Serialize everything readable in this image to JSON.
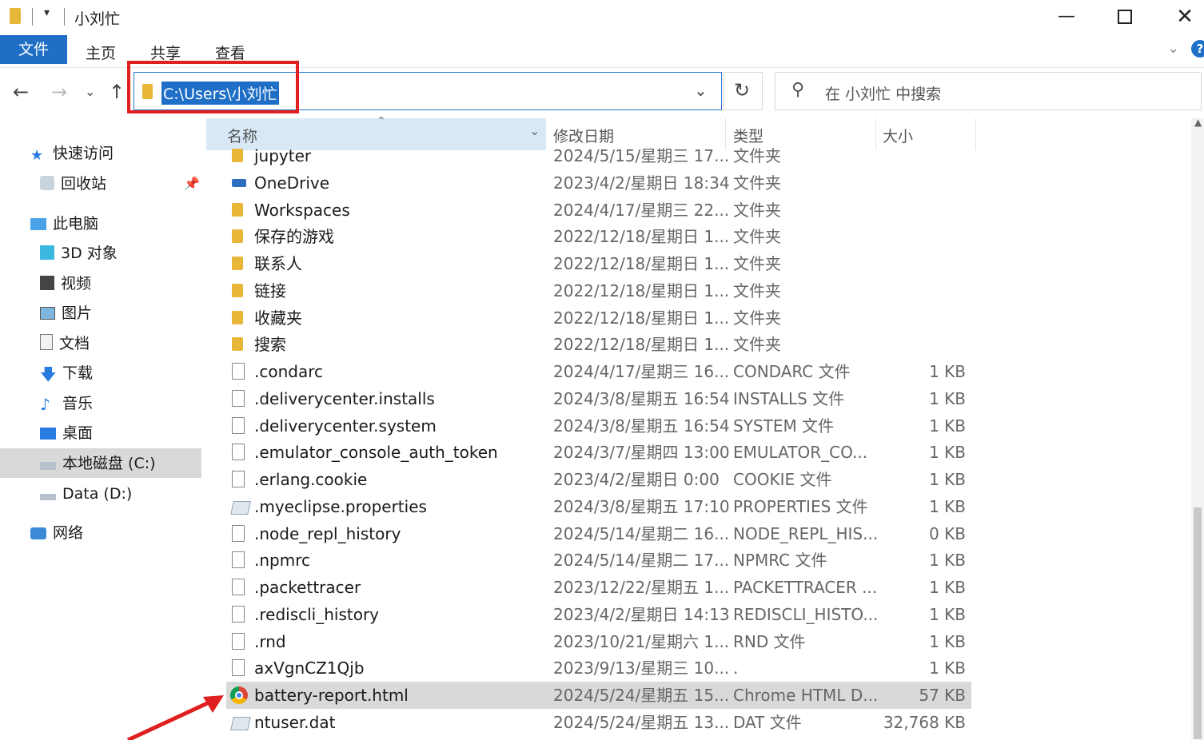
{
  "window": {
    "title": "小刘忙"
  },
  "ribbon": {
    "tabs": [
      "文件",
      "主页",
      "共享",
      "查看"
    ],
    "help": "?"
  },
  "address": {
    "path": "C:\\Users\\小刘忙"
  },
  "search": {
    "placeholder": "在 小刘忙 中搜索"
  },
  "sidebar": {
    "items": [
      {
        "label": "快速访问",
        "icon": "star-icon"
      },
      {
        "label": "回收站",
        "icon": "recycle-bin-icon"
      },
      {
        "label": "此电脑",
        "icon": "computer-icon"
      },
      {
        "label": "3D 对象",
        "icon": "cube-icon"
      },
      {
        "label": "视频",
        "icon": "video-icon"
      },
      {
        "label": "图片",
        "icon": "picture-icon"
      },
      {
        "label": "文档",
        "icon": "document-icon"
      },
      {
        "label": "下载",
        "icon": "download-icon"
      },
      {
        "label": "音乐",
        "icon": "music-icon"
      },
      {
        "label": "桌面",
        "icon": "desktop-icon"
      },
      {
        "label": "本地磁盘 (C:)",
        "icon": "drive-icon"
      },
      {
        "label": "Data (D:)",
        "icon": "drive-icon"
      },
      {
        "label": "网络",
        "icon": "network-icon"
      }
    ]
  },
  "columns": {
    "name": "名称",
    "date": "修改日期",
    "type": "类型",
    "size": "大小"
  },
  "files": [
    {
      "name": "jupyter",
      "date": "2024/5/15/星期三 17...",
      "type": "文件夹",
      "size": "",
      "icon": "folder-icon"
    },
    {
      "name": "OneDrive",
      "date": "2023/4/2/星期日 18:34",
      "type": "文件夹",
      "size": "",
      "icon": "onedrive-folder-icon"
    },
    {
      "name": "Workspaces",
      "date": "2024/4/17/星期三 22...",
      "type": "文件夹",
      "size": "",
      "icon": "folder-icon"
    },
    {
      "name": "保存的游戏",
      "date": "2022/12/18/星期日 1...",
      "type": "文件夹",
      "size": "",
      "icon": "saved-games-folder-icon"
    },
    {
      "name": "联系人",
      "date": "2022/12/18/星期日 1...",
      "type": "文件夹",
      "size": "",
      "icon": "contacts-folder-icon"
    },
    {
      "name": "链接",
      "date": "2022/12/18/星期日 1...",
      "type": "文件夹",
      "size": "",
      "icon": "links-folder-icon"
    },
    {
      "name": "收藏夹",
      "date": "2022/12/18/星期日 1...",
      "type": "文件夹",
      "size": "",
      "icon": "favorites-folder-icon"
    },
    {
      "name": "搜索",
      "date": "2022/12/18/星期日 1...",
      "type": "文件夹",
      "size": "",
      "icon": "search-folder-icon"
    },
    {
      "name": ".condarc",
      "date": "2024/4/17/星期三 16...",
      "type": "CONDARC 文件",
      "size": "1 KB",
      "icon": "file-icon"
    },
    {
      "name": ".deliverycenter.installs",
      "date": "2024/3/8/星期五 16:54",
      "type": "INSTALLS 文件",
      "size": "1 KB",
      "icon": "file-icon"
    },
    {
      "name": ".deliverycenter.system",
      "date": "2024/3/8/星期五 16:54",
      "type": "SYSTEM 文件",
      "size": "1 KB",
      "icon": "file-icon"
    },
    {
      "name": ".emulator_console_auth_token",
      "date": "2024/3/7/星期四 13:00",
      "type": "EMULATOR_CO...",
      "size": "1 KB",
      "icon": "file-icon"
    },
    {
      "name": ".erlang.cookie",
      "date": "2023/4/2/星期日 0:00",
      "type": "COOKIE 文件",
      "size": "1 KB",
      "icon": "file-icon"
    },
    {
      "name": ".myeclipse.properties",
      "date": "2024/3/8/星期五 17:10",
      "type": "PROPERTIES 文件",
      "size": "1 KB",
      "icon": "properties-file-icon"
    },
    {
      "name": ".node_repl_history",
      "date": "2024/5/14/星期二 16...",
      "type": "NODE_REPL_HIS...",
      "size": "0 KB",
      "icon": "file-icon"
    },
    {
      "name": ".npmrc",
      "date": "2024/5/14/星期二 17...",
      "type": "NPMRC 文件",
      "size": "1 KB",
      "icon": "file-icon"
    },
    {
      "name": ".packettracer",
      "date": "2023/12/22/星期五 1...",
      "type": "PACKETTRACER ...",
      "size": "1 KB",
      "icon": "file-icon"
    },
    {
      "name": ".rediscli_history",
      "date": "2023/4/2/星期日 14:13",
      "type": "REDISCLI_HISTO...",
      "size": "1 KB",
      "icon": "file-icon"
    },
    {
      "name": ".rnd",
      "date": "2023/10/21/星期六 1...",
      "type": "RND 文件",
      "size": "1 KB",
      "icon": "file-icon"
    },
    {
      "name": "axVgnCZ1Qjb",
      "date": "2023/9/13/星期三 10...",
      "type": ".",
      "size": "1 KB",
      "icon": "file-icon"
    },
    {
      "name": "battery-report.html",
      "date": "2024/5/24/星期五 15...",
      "type": "Chrome HTML D...",
      "size": "57 KB",
      "icon": "chrome-icon"
    },
    {
      "name": "ntuser.dat",
      "date": "2024/5/24/星期五 13...",
      "type": "DAT 文件",
      "size": "32,768 KB",
      "icon": "system-file-icon"
    }
  ],
  "colors": {
    "accent": "#1f6fc7",
    "highlight": "#e02020",
    "selected_row": "#d9d9d9",
    "header_bg": "#d9e8f7"
  }
}
